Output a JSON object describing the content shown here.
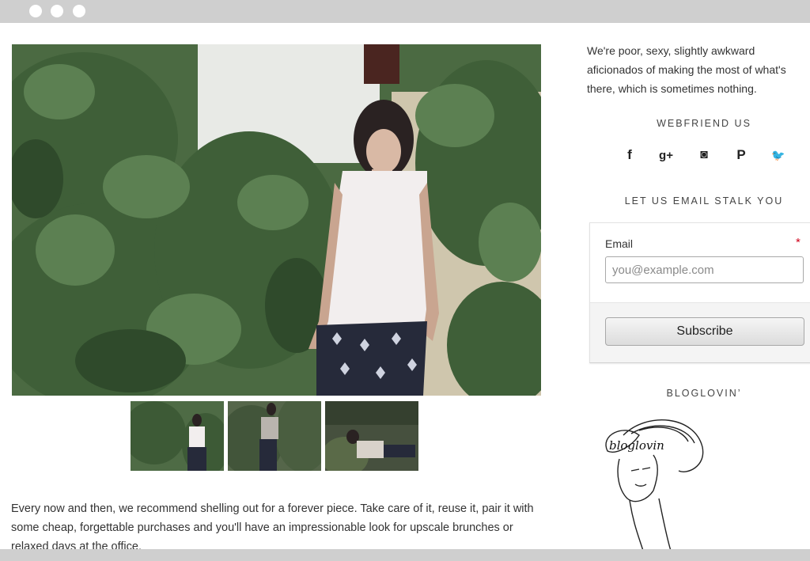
{
  "browser": {
    "window_controls": [
      "close-dot",
      "minimize-dot",
      "maximize-dot"
    ]
  },
  "post": {
    "body_text": "Every now and then, we recommend shelling out for a forever piece. Take care of it, reuse it, pair it with some cheap, forgettable purchases and you'll have an impressionable look for upscale brunches or relaxed days at the office."
  },
  "sidebar": {
    "about_text": "We're poor, sexy, slightly awkward aficionados of making the most of what's there, which is sometimes nothing.",
    "webfriend_title": "WEBFRIEND US",
    "social_icons": [
      {
        "name": "facebook-icon",
        "glyph": "f"
      },
      {
        "name": "google-plus-icon",
        "glyph": "g+"
      },
      {
        "name": "instagram-icon",
        "glyph": "◙"
      },
      {
        "name": "pinterest-icon",
        "glyph": "P"
      },
      {
        "name": "twitter-icon",
        "glyph": "🐦"
      }
    ],
    "email_title": "LET US EMAIL STALK YOU",
    "email_form": {
      "label": "Email",
      "required_mark": "*",
      "placeholder": "you@example.com",
      "value": "",
      "button_label": "Subscribe"
    },
    "bloglovin_title": "BLOGLOVIN’"
  }
}
